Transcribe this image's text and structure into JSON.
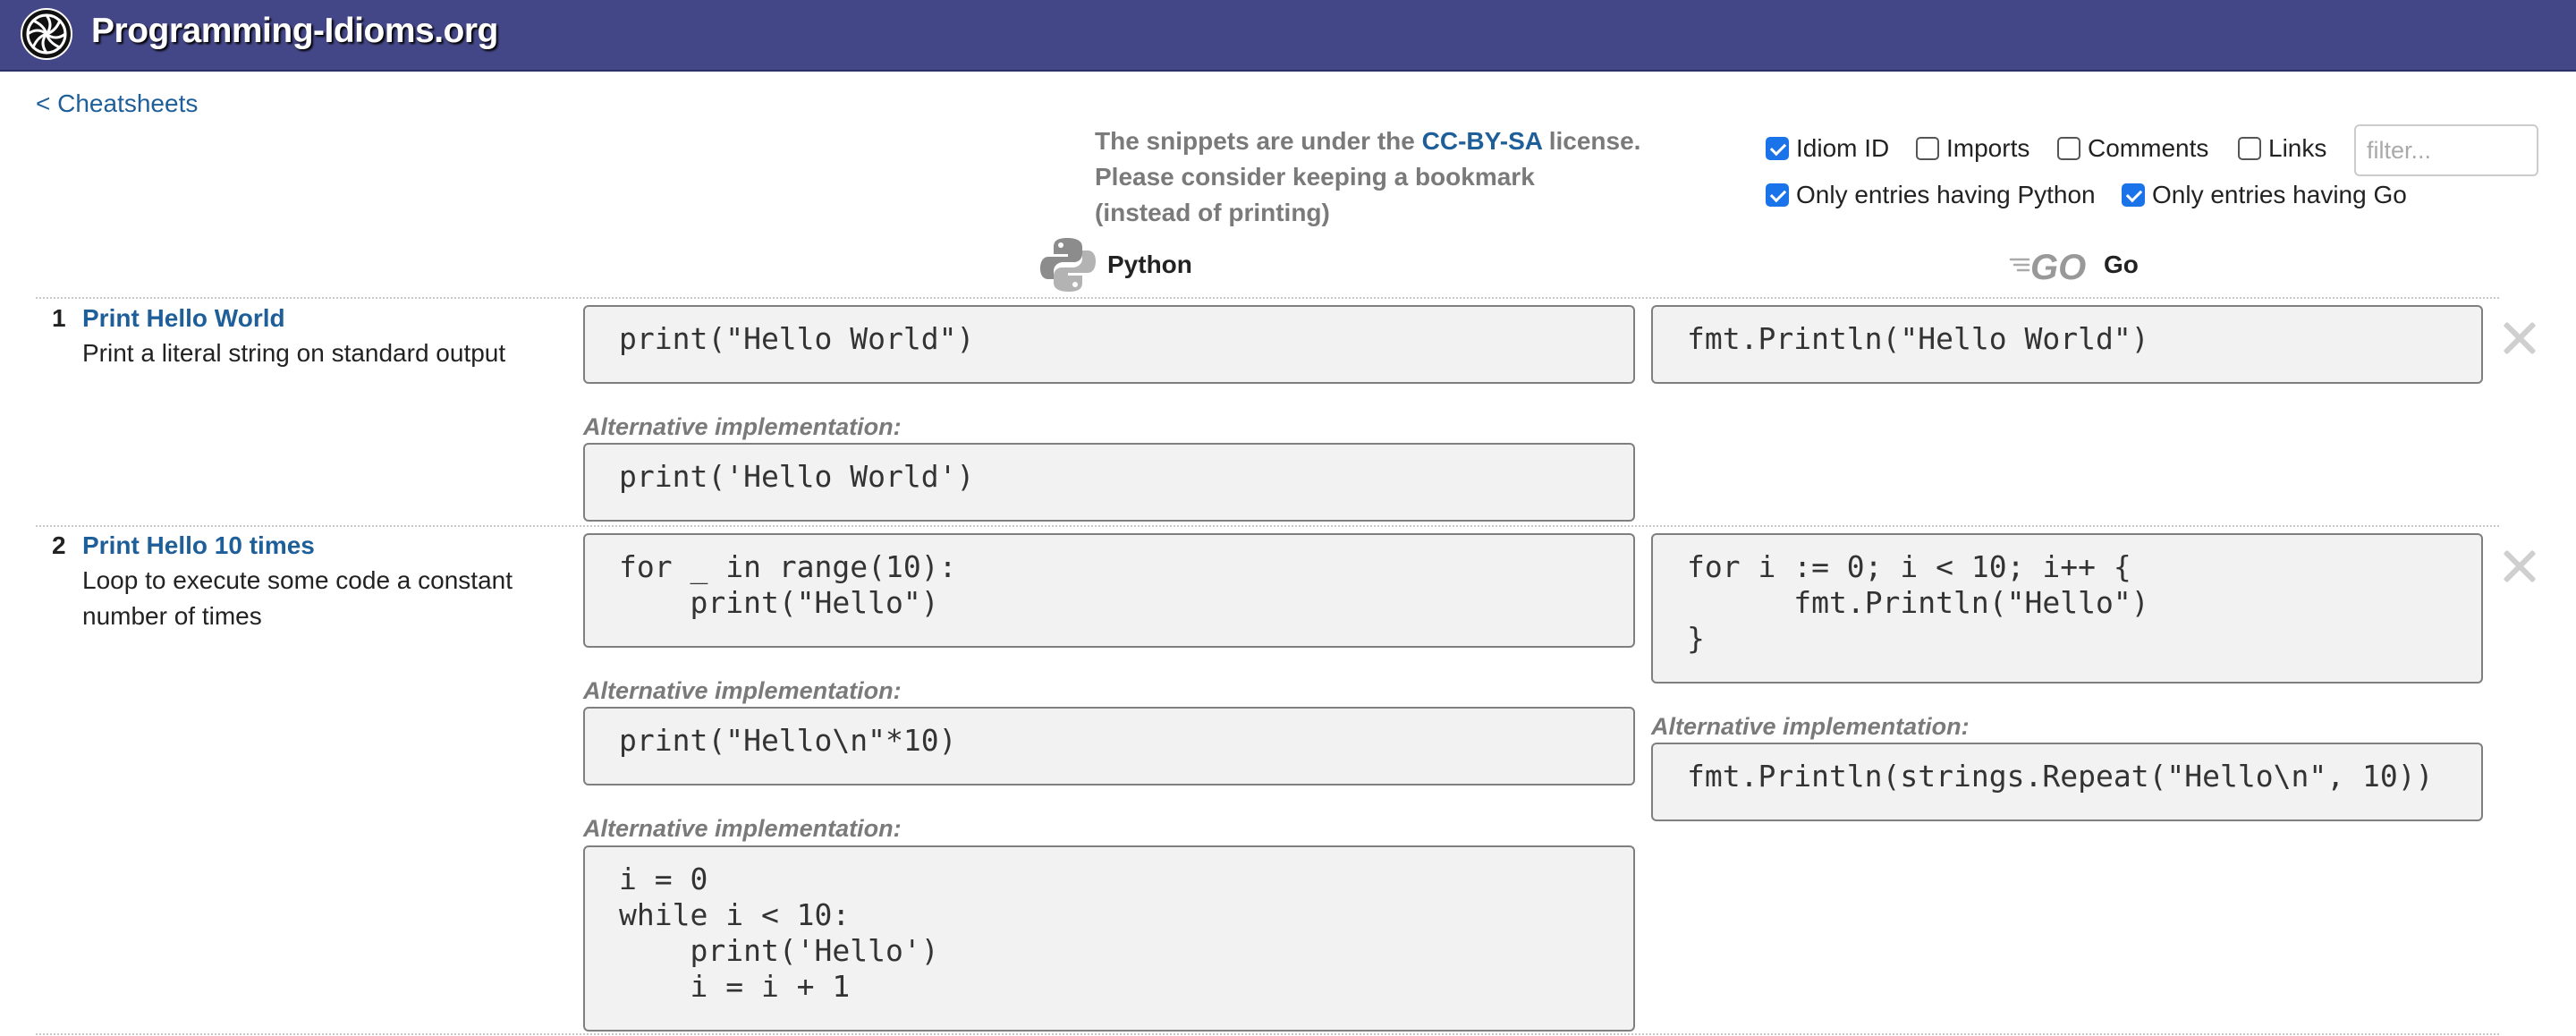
{
  "header": {
    "title": "Programming-Idioms.org",
    "logo_icon": "programming-idioms-logo-icon"
  },
  "nav": {
    "back_label": "< Cheatsheets"
  },
  "license": {
    "line1_prefix": "The snippets are under the ",
    "link_label": "CC-BY-SA",
    "line1_suffix": " license.",
    "line2": "Please consider keeping a bookmark",
    "line3": "(instead of printing)"
  },
  "options": {
    "idiom_id": {
      "label": "Idiom ID",
      "checked": true
    },
    "imports": {
      "label": "Imports",
      "checked": false
    },
    "comments": {
      "label": "Comments",
      "checked": false
    },
    "links": {
      "label": "Links",
      "checked": false
    },
    "only_python": {
      "label": "Only entries having Python",
      "checked": true
    },
    "only_go": {
      "label": "Only entries having Go",
      "checked": true
    },
    "filter_placeholder": "filter..."
  },
  "languages": {
    "left": {
      "name": "Python",
      "icon": "python-logo-icon"
    },
    "right": {
      "name": "Go",
      "icon": "go-logo-icon"
    }
  },
  "alt_label": "Alternative implementation:",
  "idioms": [
    {
      "num": "1",
      "title": "Print Hello World",
      "desc": "Print a literal string on standard output",
      "python": [
        "print(\"Hello World\")",
        "print('Hello World')"
      ],
      "go": [
        "fmt.Println(\"Hello World\")"
      ]
    },
    {
      "num": "2",
      "title": "Print Hello 10 times",
      "desc_line1": "Loop to execute some code a constant",
      "desc_line2": "number of times",
      "python": [
        "for _ in range(10):\n    print(\"Hello\")",
        "print(\"Hello\\n\"*10)",
        "i = 0\nwhile i < 10:\n    print('Hello')\n    i = i + 1"
      ],
      "go": [
        "for i := 0; i < 10; i++ {\n\tfmt.Println(\"Hello\")\n}",
        "fmt.Println(strings.Repeat(\"Hello\\n\", 10))"
      ]
    }
  ],
  "colors": {
    "header_bg": "#444787",
    "link": "#1f5f99",
    "code_bg": "#f2f2f2",
    "checkbox": "#1a73e8"
  }
}
